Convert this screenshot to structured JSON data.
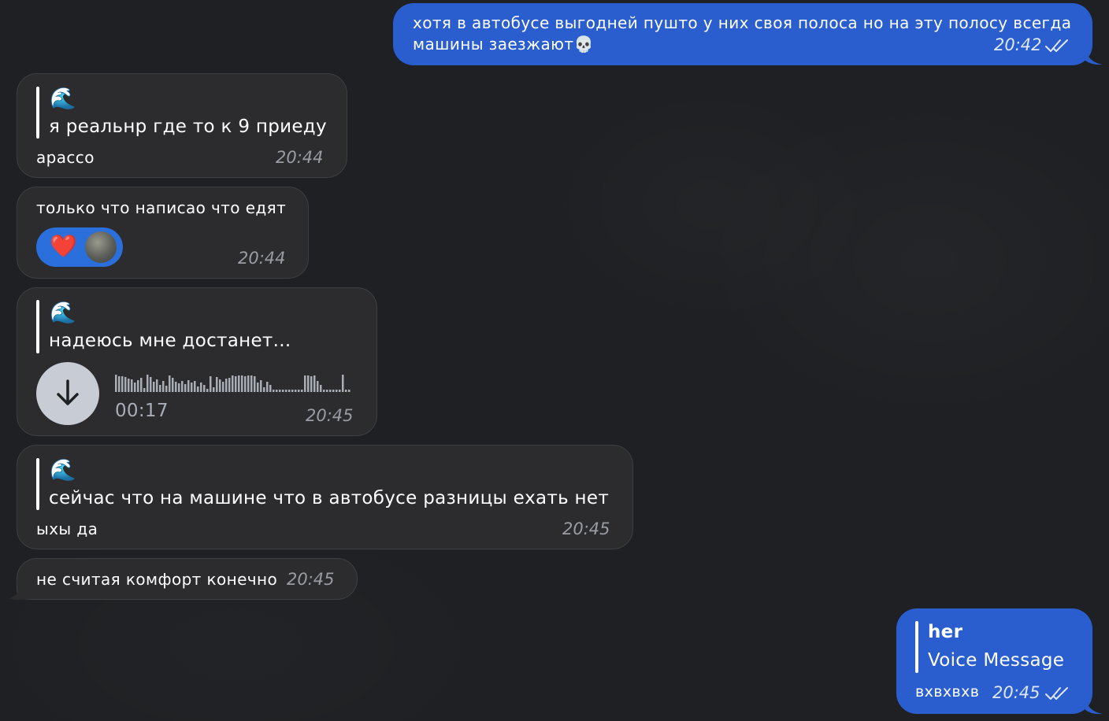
{
  "colors": {
    "background": "#1e2023",
    "incoming_bubble": "#2c2c2e",
    "outgoing_bubble": "#2a5ecf",
    "reaction_pill": "#2a6fdb",
    "time_incoming": "#9a9ca3"
  },
  "messages": [
    {
      "direction": "outgoing",
      "line1": "хотя в автобусе выгодней пушто у них своя полоса но на эту полосу всегда",
      "line2": "машины заезжают",
      "emoji": "💀",
      "time": "20:42",
      "status_icon": "double-check-icon"
    },
    {
      "direction": "incoming",
      "quote_emoji": "🌊",
      "quote_text": "я реальнр где то к 9 приеду",
      "text": "арассо",
      "time": "20:44"
    },
    {
      "direction": "incoming",
      "text": "только что написао что едят",
      "reaction": "❤️",
      "time": "20:44"
    },
    {
      "direction": "incoming",
      "quote_emoji": "🌊",
      "quote_text": "надеюсь мне достанет...",
      "voice_duration": "00:17",
      "voice_progress": 0,
      "time": "20:45"
    },
    {
      "direction": "incoming",
      "quote_emoji": "🌊",
      "quote_text": "сейчас что на машине что в автобусе разницы ехать нет",
      "text": "ыхы да",
      "time": "20:45"
    },
    {
      "direction": "incoming",
      "text": "не считая комфорт конечно",
      "time": "20:45"
    },
    {
      "direction": "outgoing",
      "quote_title": "her",
      "quote_text": "Voice Message",
      "text": "вхвхвхв",
      "time": "20:45",
      "status_icon": "double-check-icon"
    }
  ]
}
